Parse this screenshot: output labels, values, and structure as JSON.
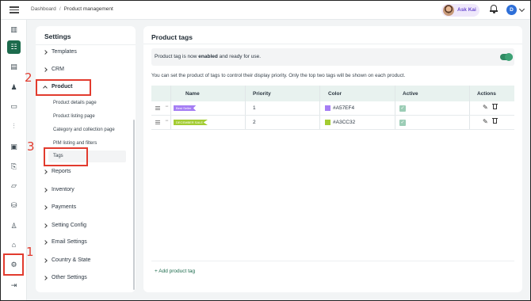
{
  "topbar": {
    "breadcrumb": [
      "Dashboard",
      "Product management"
    ],
    "breadcrumb_sep": "/",
    "ask_kai_label": "Ask Kai",
    "user_initial": "D"
  },
  "rail": {
    "icons": [
      "layout-icon",
      "checklist-icon",
      "document-icon",
      "users-icon",
      "chat-icon",
      "chart-icon",
      "clipboard-icon",
      "file-search-icon",
      "folder-icon",
      "stack-icon",
      "person-add-icon",
      "store-icon",
      "settings-icon",
      "logout-icon"
    ],
    "active": "checklist-icon"
  },
  "settings": {
    "title": "Settings",
    "sections": {
      "templates": "Templates",
      "crm": "CRM",
      "product": "Product",
      "reports": "Reports",
      "inventory": "Inventory",
      "payments": "Payments",
      "setting_config": "Setting Config",
      "email_settings": "Email Settings",
      "country_state": "Country & State",
      "other_settings": "Other Settings"
    },
    "product_items": [
      "Product details page",
      "Product listing page",
      "Category and collection page",
      "PIM listing and filters",
      "Tags"
    ],
    "selected_item": "Tags"
  },
  "annotations": [
    "1",
    "2",
    "3"
  ],
  "main": {
    "title": "Product tags",
    "banner": {
      "prefix": "Product tag is now ",
      "emphasis": "enabled",
      "suffix": " and ready for use.",
      "toggle_on": true
    },
    "note": "You can set the product of tags to control their display priority. Only the top two tags will be shown on each product.",
    "table": {
      "headers": {
        "name": "Name",
        "priority": "Priority",
        "color": "Color",
        "active": "Active",
        "actions": "Actions"
      },
      "rows": [
        {
          "tag_label": "Best Seller",
          "priority": "1",
          "color": "#A57EF4",
          "active": true
        },
        {
          "tag_label": "DECEMBER SALE",
          "priority": "2",
          "color": "#A3CC32",
          "active": true
        }
      ]
    },
    "add_tag_label": "+ Add product tag"
  },
  "colors": {
    "accent": "#1d6b4d",
    "annotation": "#e23b2e",
    "ask_kai": "#6b4bd1"
  }
}
